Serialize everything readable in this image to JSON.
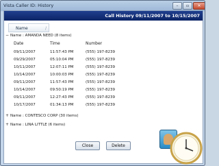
{
  "window": {
    "title": "Vista Caller ID: History"
  },
  "header": {
    "title": "Call History 09/11/2007 to 10/15/2007"
  },
  "group_column": {
    "label": "Name"
  },
  "groups": [
    {
      "label": "Name : AMANDA NEED (8 items)",
      "expanded": true
    },
    {
      "label": "Name : CONTESCO CORP (30 items)",
      "expanded": false
    },
    {
      "label": "Name : LINA LITTLE (6 items)",
      "expanded": false
    }
  ],
  "columns": {
    "date": "Date",
    "time": "Time",
    "number": "Number"
  },
  "rows": [
    {
      "date": "09/11/2007",
      "time": "11:57:43 PM",
      "number": "(555) 197-8239"
    },
    {
      "date": "09/29/2007",
      "time": "05:10:04 PM",
      "number": "(555) 197-8239"
    },
    {
      "date": "10/11/2007",
      "time": "12:07:11 PM",
      "number": "(555) 197-8239"
    },
    {
      "date": "10/14/2007",
      "time": "10:00:03 PM",
      "number": "(555) 197-8239"
    },
    {
      "date": "09/11/2007",
      "time": "11:57:43 PM",
      "number": "(555) 197-8239"
    },
    {
      "date": "10/14/2007",
      "time": "09:50:19 PM",
      "number": "(555) 197-8239"
    },
    {
      "date": "09/11/2007",
      "time": "12:27:43 PM",
      "number": "(555) 197-8239"
    },
    {
      "date": "10/17/2007",
      "time": "01:34:13 PM",
      "number": "(555) 197-8239"
    }
  ],
  "buttons": {
    "close": "Close",
    "delete": "Delete"
  },
  "colors": {
    "header_bg": "#0d2466",
    "header_text": "#ffffff"
  },
  "icons": {
    "app": "caller-id-app-icon",
    "clock": "clock-icon"
  }
}
